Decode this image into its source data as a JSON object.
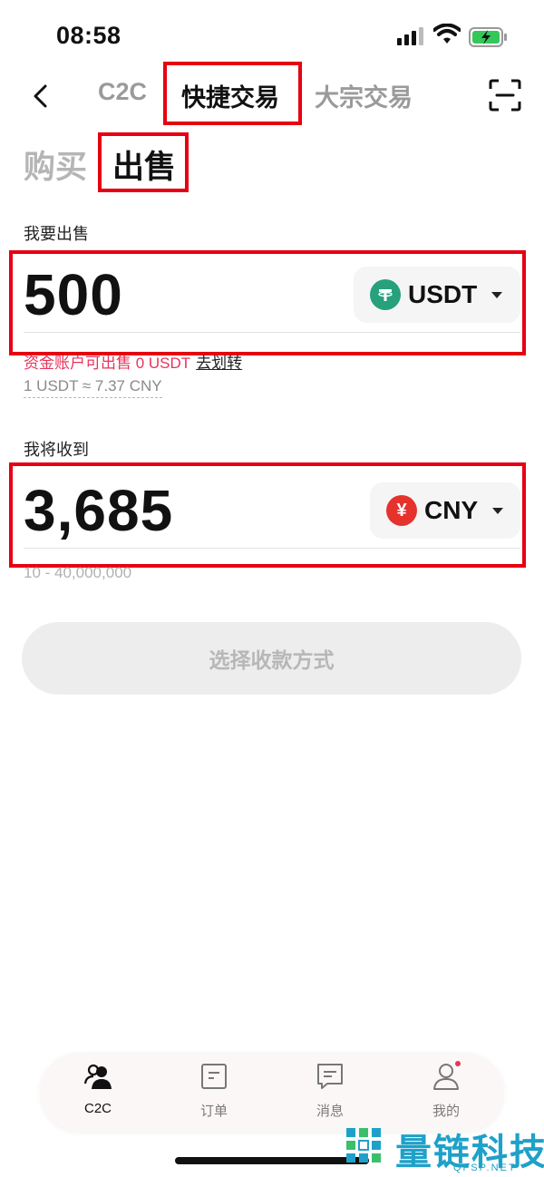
{
  "status_bar": {
    "time": "08:58"
  },
  "nav": {
    "tabs": [
      {
        "label": "C2C",
        "active": false
      },
      {
        "label": "快捷交易",
        "active": true
      },
      {
        "label": "大宗交易",
        "active": false
      }
    ]
  },
  "side_tabs": [
    {
      "label": "购买",
      "active": false
    },
    {
      "label": "出售",
      "active": true
    }
  ],
  "sell": {
    "label": "我要出售",
    "amount": "500",
    "currency": "USDT",
    "available_text": "资金账户可出售 0 USDT",
    "transfer_link": "去划转",
    "rate": "1 USDT ≈ 7.37 CNY"
  },
  "receive": {
    "label": "我将收到",
    "amount": "3,685",
    "currency": "CNY",
    "range": "10 - 40,000,000"
  },
  "cta": {
    "label": "选择收款方式"
  },
  "bottom_nav": [
    {
      "label": "C2C",
      "icon": "users-icon",
      "active": true
    },
    {
      "label": "订单",
      "icon": "order-icon",
      "active": false
    },
    {
      "label": "消息",
      "icon": "message-icon",
      "active": false
    },
    {
      "label": "我的",
      "icon": "profile-icon",
      "active": false,
      "badge": true
    }
  ],
  "watermark": {
    "text": "量链科技",
    "sub": "QFSP.NET"
  },
  "colors": {
    "highlight_box": "#e60012",
    "usdt": "#26a17b",
    "cny": "#e5322d",
    "available_text": "#e8335b",
    "watermark": "#1ea1c9"
  }
}
